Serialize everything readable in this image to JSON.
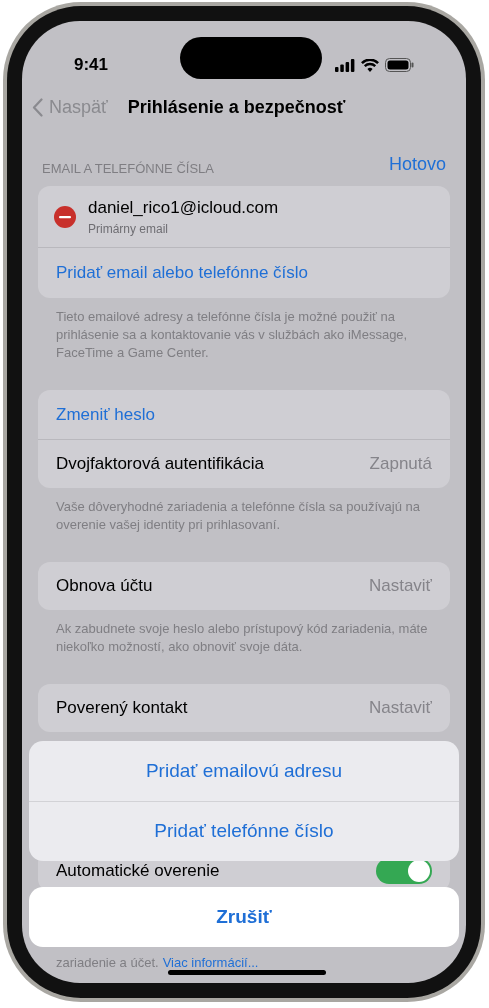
{
  "status_bar": {
    "time": "9:41"
  },
  "nav": {
    "back": "Naspäť",
    "title": "Prihlásenie a bezpečnosť"
  },
  "email_section": {
    "header": "EMAIL A TELEFÓNNE ČÍSLA",
    "done": "Hotovo",
    "emails": [
      {
        "address": "daniel_rico1@icloud.com",
        "caption": "Primárny email"
      }
    ],
    "add": "Pridať email alebo telefónne číslo",
    "footer": "Tieto emailové adresy a telefónne čísla je možné použiť na prihlásenie sa a kontaktovanie vás v službách ako iMessage, FaceTime a Game Center."
  },
  "groups": [
    {
      "rows": [
        {
          "kind": "link",
          "label": "Zmeniť heslo"
        },
        {
          "kind": "value",
          "label": "Dvojfaktorová autentifikácia",
          "value": "Zapnutá"
        }
      ],
      "footer": "Vaše dôveryhodné zariadenia a telefónne čísla sa používajú na overenie vašej identity pri prihlasovaní."
    },
    {
      "rows": [
        {
          "kind": "value",
          "label": "Obnova účtu",
          "value": "Nastaviť"
        }
      ],
      "footer": "Ak zabudnete svoje heslo alebo prístupový kód zariadenia, máte niekoľko možností, ako obnoviť svoje dáta."
    },
    {
      "rows": [
        {
          "kind": "value",
          "label": "Poverený kontakt",
          "value": "Nastaviť"
        }
      ]
    }
  ],
  "auto_verify": {
    "label": "Automatické overenie",
    "on": true
  },
  "bottom_note": {
    "text": "zariadenie a účet.",
    "link": "Viac informácií..."
  },
  "action_sheet": {
    "actions": [
      "Pridať emailovú adresu",
      "Pridať telefónne číslo"
    ],
    "cancel": "Zrušiť"
  }
}
